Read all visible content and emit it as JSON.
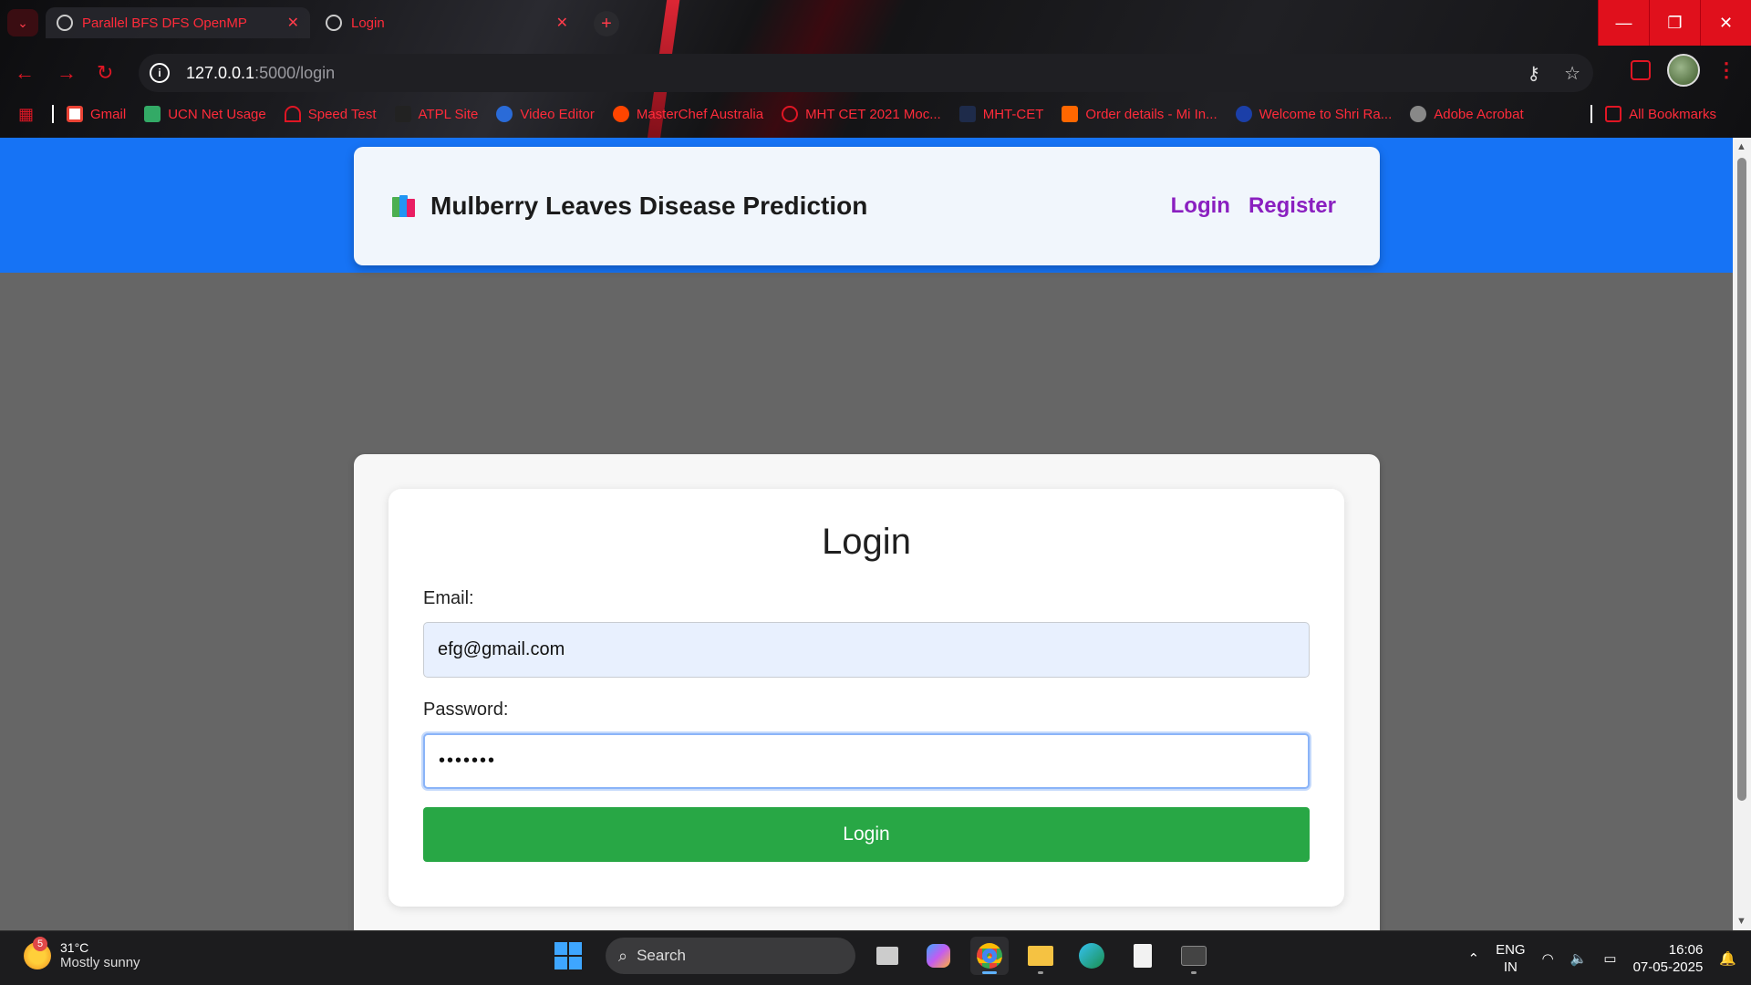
{
  "browser": {
    "tabs": [
      {
        "title": "Parallel BFS DFS OpenMP",
        "active": true
      },
      {
        "title": "Login",
        "active": false
      }
    ],
    "url_host": "127.0.0.1",
    "url_path": ":5000/login",
    "bookmarks": [
      {
        "label": "Gmail",
        "icon": "gmail-icon"
      },
      {
        "label": "UCN Net Usage",
        "icon": "network-icon"
      },
      {
        "label": "Speed Test",
        "icon": "speedometer-icon"
      },
      {
        "label": "ATPL Site",
        "icon": "site-icon"
      },
      {
        "label": "Video Editor",
        "icon": "globe-icon"
      },
      {
        "label": "MasterChef Australia",
        "icon": "reddit-icon"
      },
      {
        "label": "MHT CET 2021 Moc...",
        "icon": "site-icon"
      },
      {
        "label": "MHT-CET",
        "icon": "site-icon"
      },
      {
        "label": "Order details - Mi In...",
        "icon": "mi-icon"
      },
      {
        "label": "Welcome to Shri Ra...",
        "icon": "site-icon"
      },
      {
        "label": "Adobe Acrobat",
        "icon": "globe-icon"
      }
    ],
    "all_bookmarks": "All Bookmarks",
    "accent": "#e01624"
  },
  "site": {
    "brand_title": "Mulberry Leaves Disease Prediction",
    "nav": {
      "login": "Login",
      "register": "Register"
    },
    "header_color": "#1673f5",
    "link_color": "#8a1fc0"
  },
  "login_form": {
    "title": "Login",
    "email_label": "Email:",
    "email_value": "efg@gmail.com",
    "password_label": "Password:",
    "password_value": "•••••••",
    "submit_label": "Login",
    "submit_color": "#28a745"
  },
  "taskbar": {
    "weather_badge": "5",
    "temperature": "31°C",
    "weather_desc": "Mostly sunny",
    "search_label": "Search",
    "lang_line1": "ENG",
    "lang_line2": "IN",
    "time": "16:06",
    "date": "07-05-2025"
  }
}
